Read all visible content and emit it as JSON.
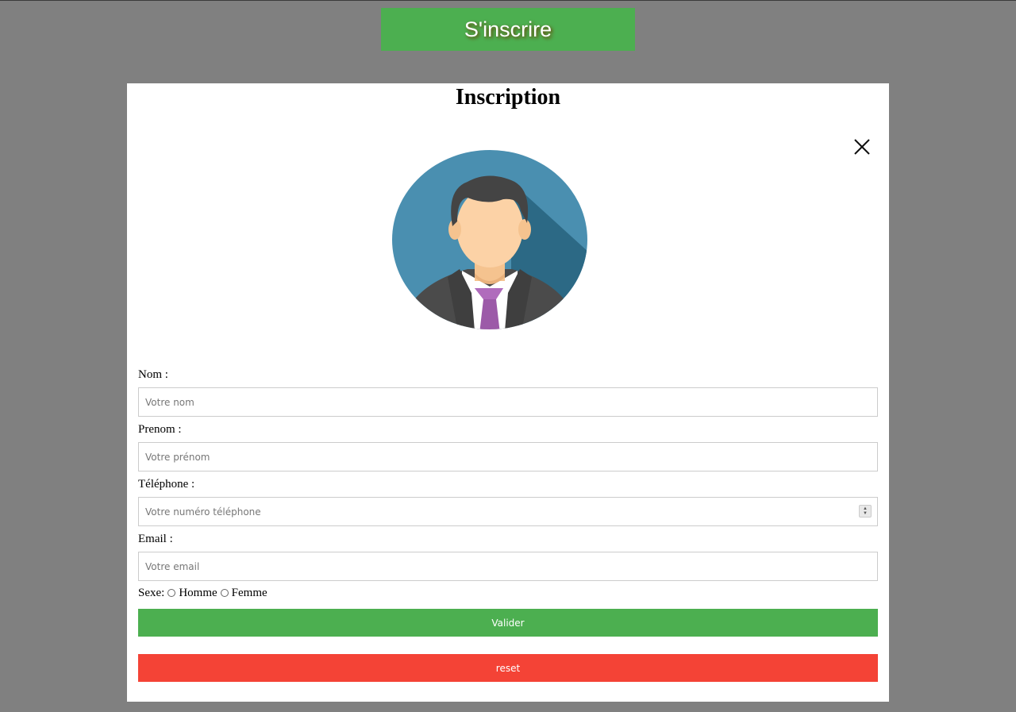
{
  "header": {
    "open_button_label": "S'inscrire"
  },
  "modal": {
    "title": "Inscription",
    "fields": {
      "nom": {
        "label": "Nom :",
        "placeholder": "Votre nom",
        "value": ""
      },
      "prenom": {
        "label": "Prenom :",
        "placeholder": "Votre prénom",
        "value": ""
      },
      "telephone": {
        "label": "Téléphone :",
        "placeholder": "Votre numéro téléphone",
        "value": ""
      },
      "email": {
        "label": "Email :",
        "placeholder": "Votre email",
        "value": ""
      }
    },
    "sexe": {
      "label": "Sexe:",
      "options": [
        "Homme",
        "Femme"
      ],
      "selected": null
    },
    "buttons": {
      "valider": "Valider",
      "reset": "reset"
    }
  },
  "colors": {
    "overlay": "#808080",
    "primary_green": "#4caf50",
    "reset_red": "#f44336",
    "avatar_bg": "#4a8fb0"
  },
  "icons": {
    "close": "close-icon",
    "avatar": "user-avatar-icon"
  }
}
